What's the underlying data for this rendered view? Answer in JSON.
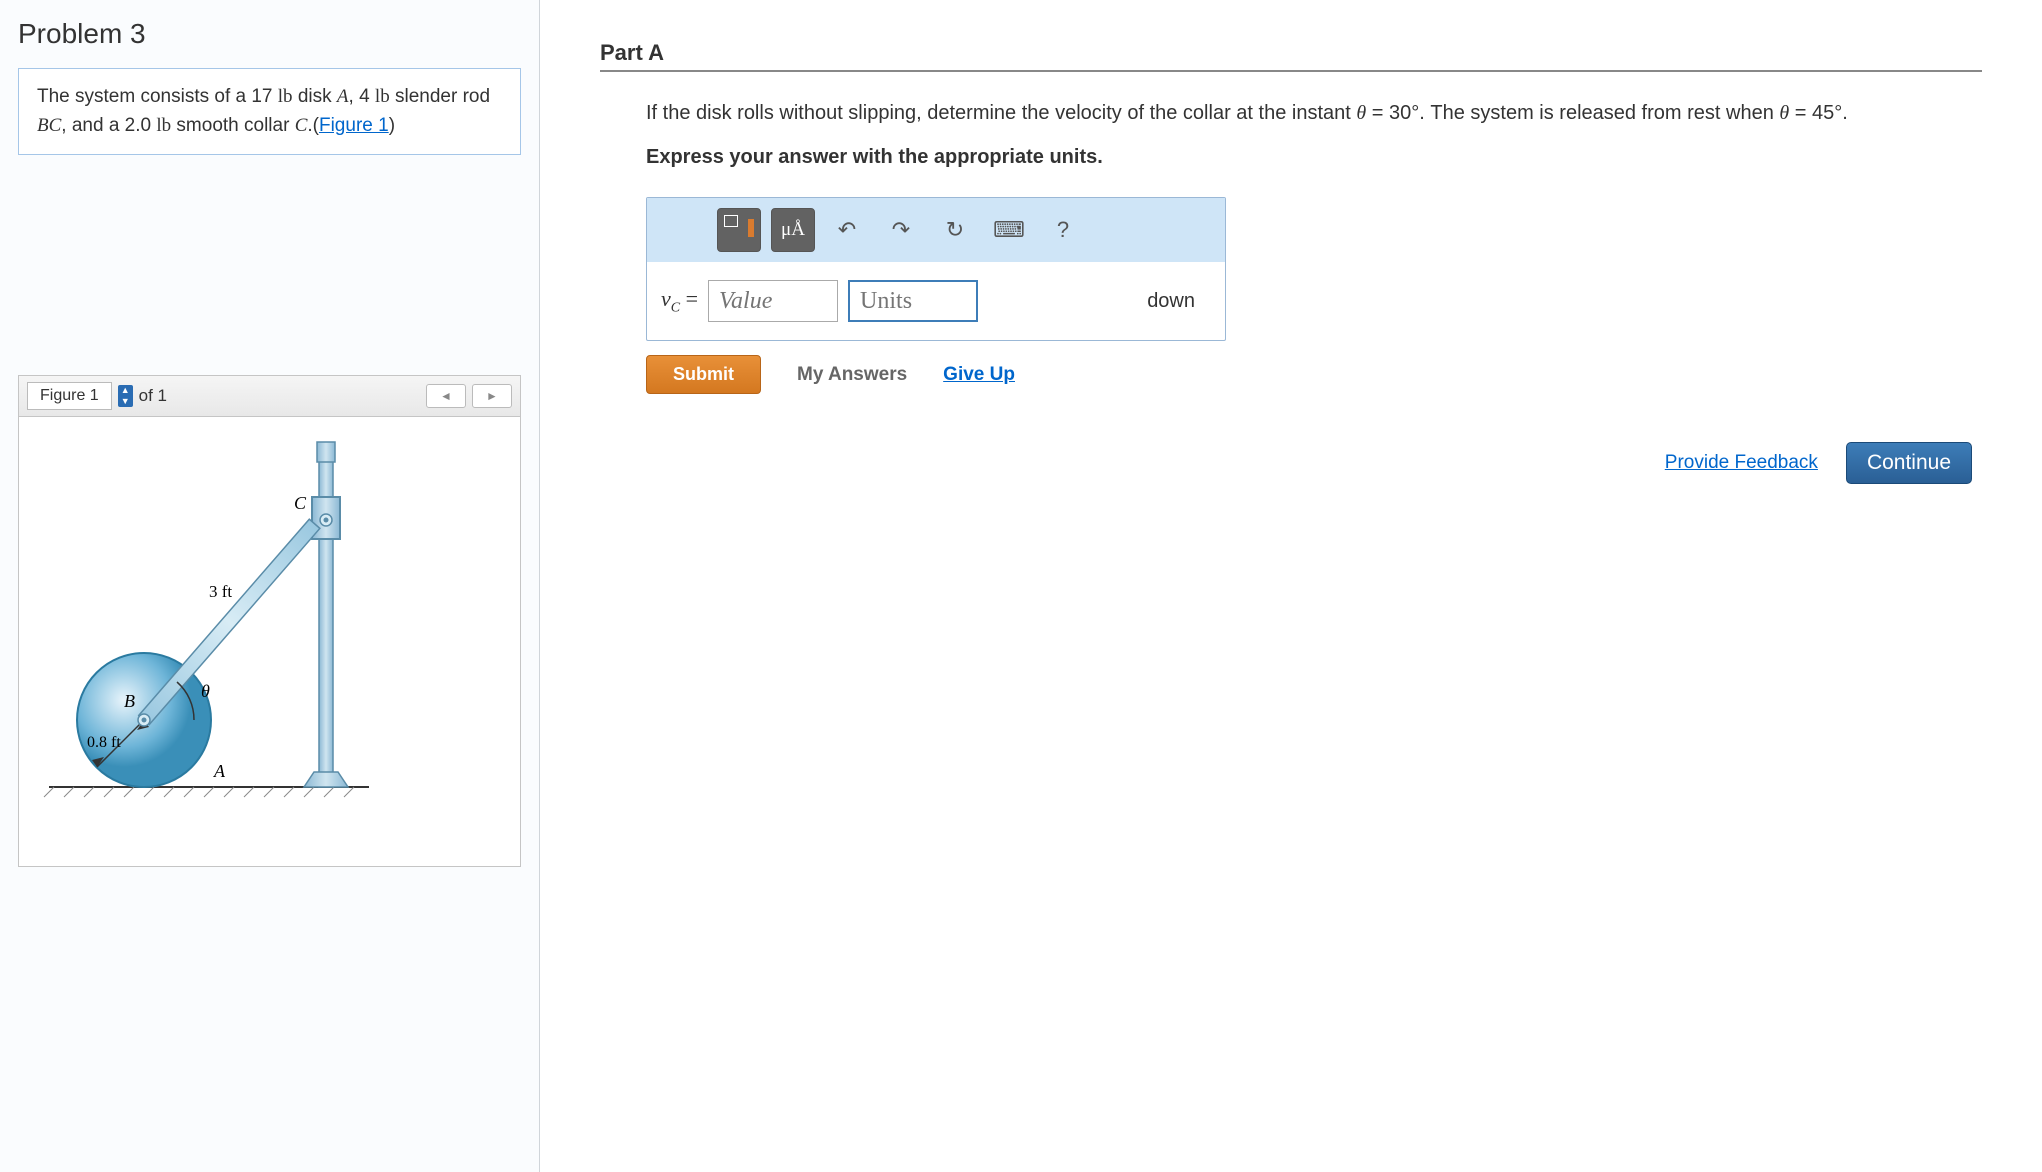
{
  "problem": {
    "title": "Problem 3",
    "desc_prefix": "The system consists of a 17 ",
    "desc_lb1": "lb",
    "desc_disk": " disk ",
    "desc_A": "A",
    "desc_mid": ", 4 ",
    "desc_lb2": "lb",
    "desc_rod": " slender rod ",
    "desc_BC": "BC",
    "desc_collar_pre": ", and a 2.0 ",
    "desc_lb3": "lb",
    "desc_collar": " smooth collar ",
    "desc_C": "C",
    "desc_period": ".(",
    "figure_link": "Figure 1",
    "desc_close": ")"
  },
  "figure": {
    "label": "Figure 1",
    "of_text": "of 1",
    "diagram": {
      "rod_label": "3 ft",
      "radius_label": "0.8 ft",
      "angle_label": "θ",
      "point_A": "A",
      "point_B": "B",
      "point_C": "C"
    }
  },
  "part": {
    "header": "Part A",
    "q_pre": "If the disk rolls without slipping, determine the velocity of the collar at the instant ",
    "q_theta1": "θ",
    "q_eq1": " = 30°",
    "q_mid": ". The system is released from rest when ",
    "q_theta2": "θ",
    "q_eq2": " = 45°",
    "q_end": ".",
    "instruction": "Express your answer with the appropriate units.",
    "units_btn": "μÅ",
    "help_btn": "?",
    "var_label_v": "v",
    "var_label_c": "C",
    "var_label_eq": " =",
    "value_placeholder": "Value",
    "units_placeholder": "Units",
    "direction": "down",
    "submit": "Submit",
    "my_answers": "My Answers",
    "give_up": "Give Up",
    "feedback": "Provide Feedback",
    "continue": "Continue"
  }
}
